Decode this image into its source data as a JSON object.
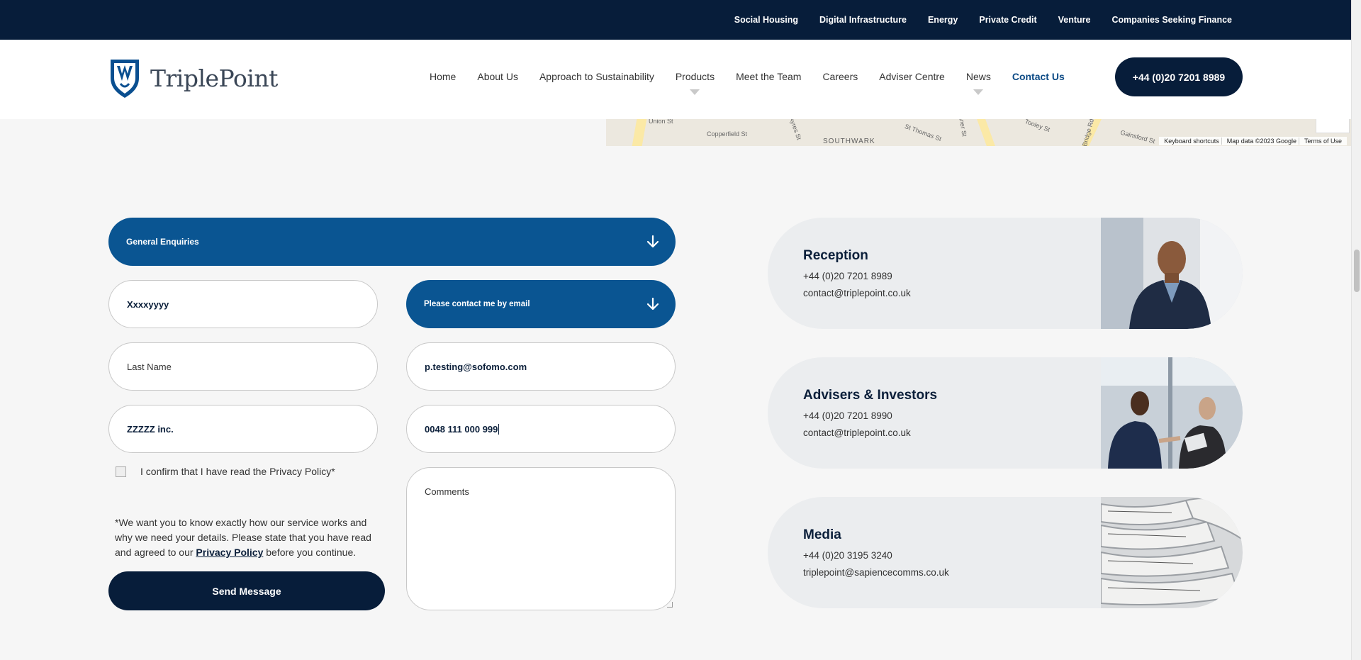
{
  "top_bar": {
    "links": [
      "Social Housing",
      "Digital Infrastructure",
      "Energy",
      "Private Credit",
      "Venture",
      "Companies Seeking Finance"
    ]
  },
  "header": {
    "logo_text": "TriplePoint",
    "nav": [
      "Home",
      "About Us",
      "Approach to Sustainability",
      "Products",
      "Meet the Team",
      "Careers",
      "Adviser Centre",
      "News",
      "Contact Us"
    ],
    "active_nav": "Contact Us",
    "phone_button": "+44 (0)20 7201 8989"
  },
  "map": {
    "streets": [
      "Union St",
      "Copperfield St",
      "Ayres St",
      "St Thomas St",
      "Joiner St",
      "Tooley St",
      "Bridge Rd",
      "Gainsford St"
    ],
    "district": "SOUTHWARK",
    "credits": [
      "Keyboard shortcuts",
      "Map data ©2023 Google",
      "Terms of Use"
    ]
  },
  "form": {
    "enquiry_type": "General Enquiries",
    "first_name": "Xxxxyyyy",
    "last_name_placeholder": "Last Name",
    "company": "ZZZZZ inc.",
    "contact_preference": "Please contact me by email",
    "email": "p.testing@sofomo.com",
    "telephone": "0048 111 000 999",
    "comments_placeholder": "Comments",
    "privacy_confirm": "I confirm that I have read the Privacy Policy*",
    "notice_before": "*We want you to know exactly how our service works and why we need your details. Please state that you have read and agreed to our ",
    "notice_link": "Privacy Policy",
    "notice_after": " before you continue.",
    "send_button": "Send Message"
  },
  "contacts": [
    {
      "title": "Reception",
      "phone": "+44 (0)20 7201 8989",
      "email": "contact@triplepoint.co.uk",
      "image": "man-portrait"
    },
    {
      "title": "Advisers & Investors",
      "phone": "+44 (0)20 7201 8990",
      "email": "contact@triplepoint.co.uk",
      "image": "handshake"
    },
    {
      "title": "Media",
      "phone": "+44 (0)20 3195 3240",
      "email": "triplepoint@sapiencecomms.co.uk",
      "image": "newspapers"
    }
  ],
  "colors": {
    "navy": "#071d3a",
    "blue": "#0a5592",
    "card_bg": "#ebedef",
    "page_bg": "#f6f6f6"
  }
}
